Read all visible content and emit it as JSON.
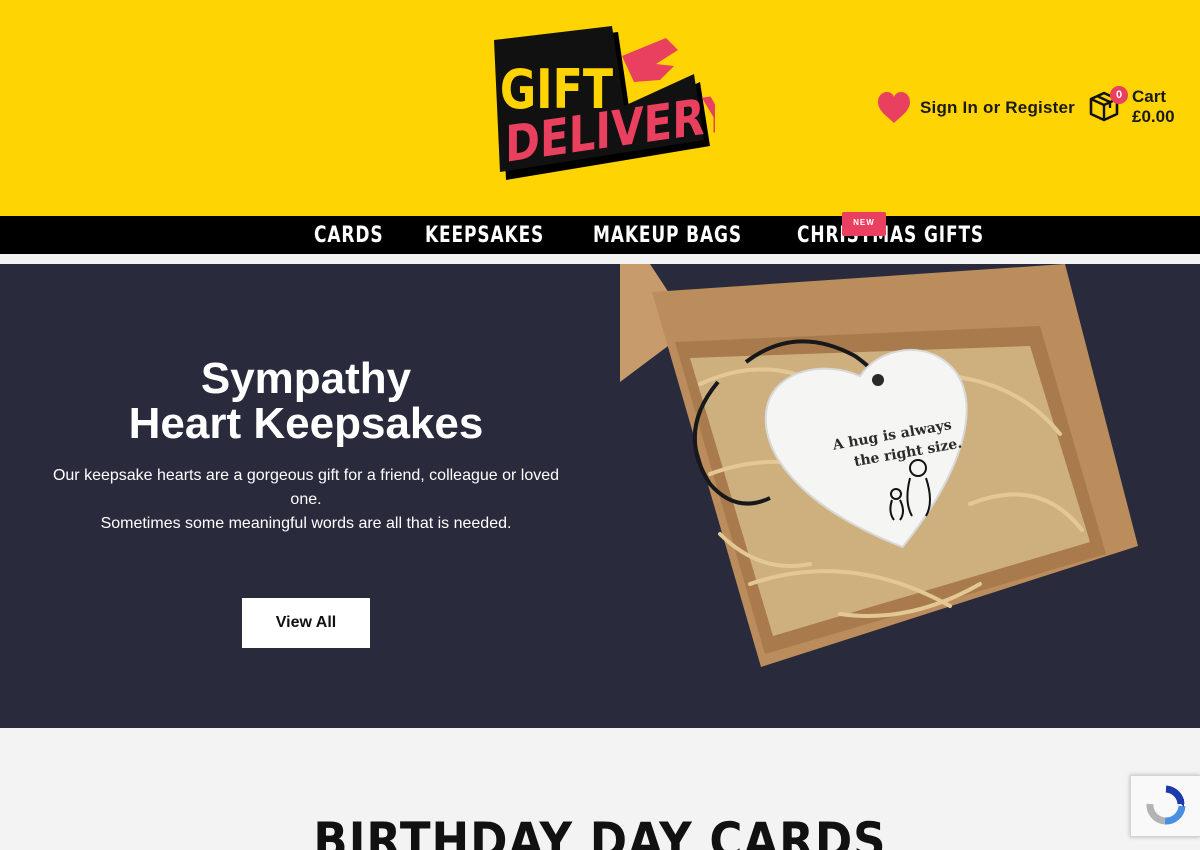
{
  "site": {
    "logo_line1": "GIFT",
    "logo_line2": "DELIVERY"
  },
  "header": {
    "account_label": "Sign In or Register",
    "cart_label": "Cart",
    "cart_count": "0",
    "cart_total": "£0.00",
    "icons": [
      "heart-icon",
      "cart-box-icon"
    ]
  },
  "nav": {
    "items": [
      {
        "label": "CARDS"
      },
      {
        "label": "KEEPSAKES"
      },
      {
        "label": "MAKEUP BAGS"
      },
      {
        "label": "CHRISTMAS GIFTS",
        "badge": "NEW"
      }
    ]
  },
  "hero": {
    "title_line1": "Sympathy",
    "title_line2": "Heart Keepsakes",
    "copy_line1": "Our keepsake hearts are a gorgeous gift for a friend, colleague or loved",
    "copy_line2": "one.",
    "copy_line3": "Sometimes some meaningful words are all that is needed.",
    "button_label": "View All",
    "image_quote_line1": "A hug is always",
    "image_quote_line2": "the right size."
  },
  "section": {
    "title": "BIRTHDAY DAY CARDS"
  },
  "colors": {
    "header_bg": "#ffd402",
    "nav_bg": "#000000",
    "hero_bg": "#292b3c",
    "accent_pink": "#e8405e",
    "page_bg": "#f3f3f3"
  }
}
